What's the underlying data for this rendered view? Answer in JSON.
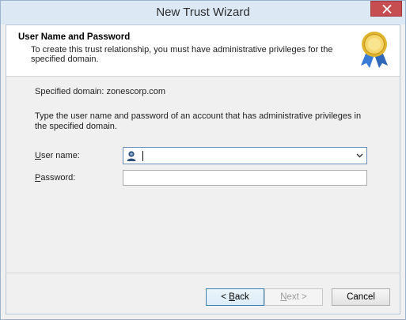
{
  "window": {
    "title": "New Trust Wizard"
  },
  "header": {
    "title": "User Name and Password",
    "subtitle": "To create this trust relationship, you must have administrative privileges for the specified domain."
  },
  "content": {
    "specified_domain": "Specified domain: zonescorp.com",
    "instruction": "Type the user name and password of an account that has administrative privileges in the specified domain."
  },
  "form": {
    "username_label_accel": "U",
    "username_label_rest": "ser name:",
    "username_value": "",
    "password_label_accel": "P",
    "password_label_rest": "assword:",
    "password_value": ""
  },
  "buttons": {
    "back_prefix": "< ",
    "back_accel": "B",
    "back_rest": "ack",
    "next_accel": "N",
    "next_rest": "ext >",
    "cancel": "Cancel"
  },
  "icons": {
    "close": "close-icon",
    "seal": "award-seal-icon",
    "user": "user-account-icon",
    "dropdown": "chevron-down-icon"
  },
  "colors": {
    "close_button": "#c74e50",
    "titlebar": "#dce9f5",
    "focus_border": "#3c7fb1"
  }
}
